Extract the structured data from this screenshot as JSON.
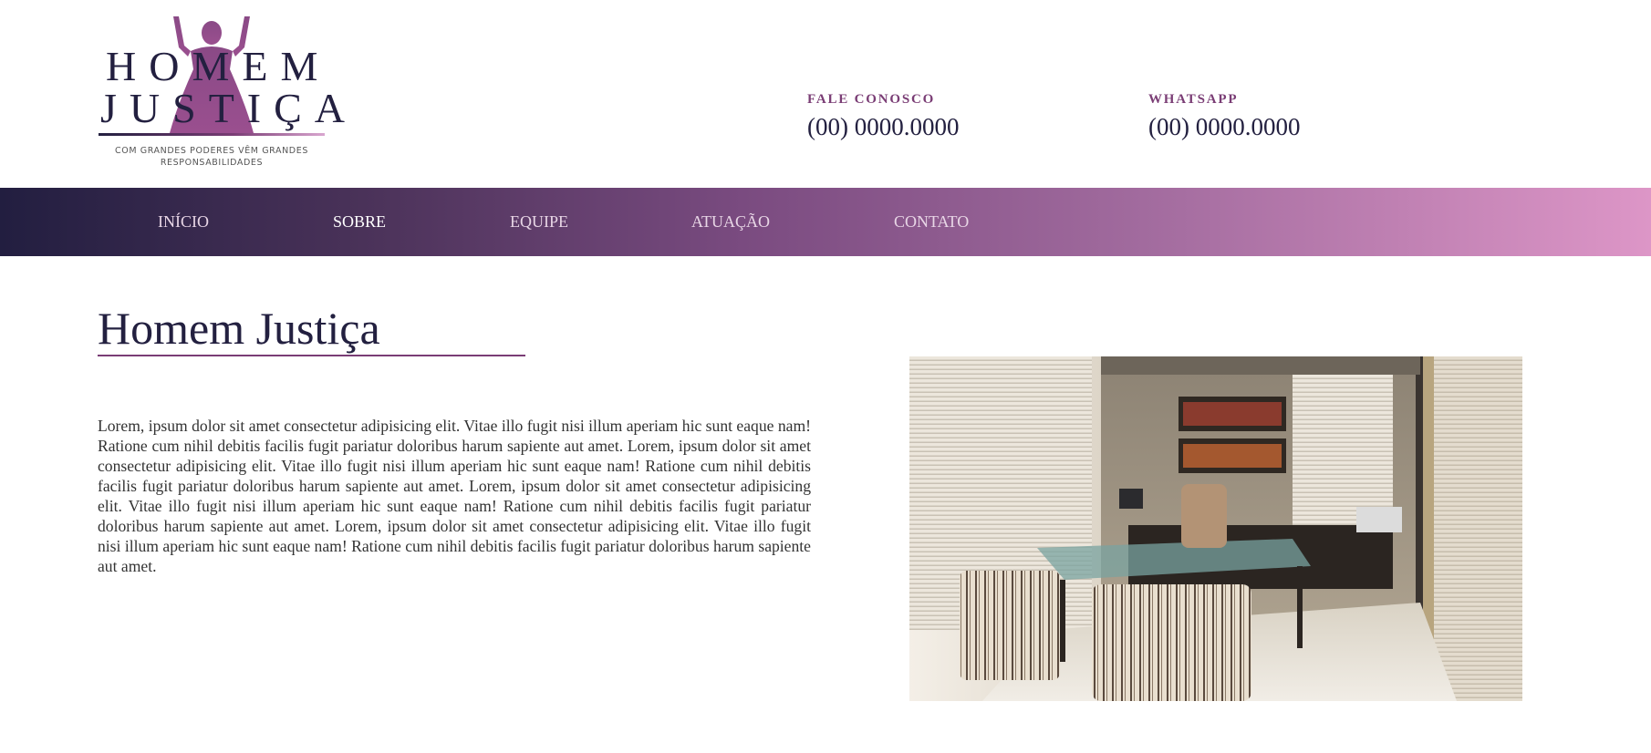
{
  "logo": {
    "line1": "HOMEM",
    "line2": "JUSTIÇA",
    "tagline_line1": "COM GRANDES PODERES VÊM GRANDES",
    "tagline_line2": "RESPONSABILIDADES",
    "figure_icon": "raised-arms-woman-silhouette"
  },
  "contacts": [
    {
      "label": "FALE CONOSCO",
      "value": "(00) 0000.0000"
    },
    {
      "label": "WHATSAPP",
      "value": "(00) 0000.0000"
    }
  ],
  "nav": {
    "items": [
      {
        "label": "INÍCIO",
        "active": false
      },
      {
        "label": "SOBRE",
        "active": true
      },
      {
        "label": "EQUIPE",
        "active": false
      },
      {
        "label": "ATUAÇÃO",
        "active": false
      },
      {
        "label": "CONTATO",
        "active": false
      }
    ]
  },
  "main": {
    "title": "Homem Justiça",
    "body": "Lorem, ipsum dolor sit amet consectetur adipisicing elit. Vitae illo fugit nisi illum aperiam hic sunt eaque nam! Ratione cum nihil debitis facilis fugit pariatur doloribus harum sapiente aut amet. Lorem, ipsum dolor sit amet consectetur adipisicing elit. Vitae illo fugit nisi illum aperiam hic sunt eaque nam! Ratione cum nihil debitis facilis fugit pariatur doloribus harum sapiente aut amet. Lorem, ipsum dolor sit amet consectetur adipisicing elit. Vitae illo fugit nisi illum aperiam hic sunt eaque nam! Ratione cum nihil debitis facilis fugit pariatur doloribus harum sapiente aut amet. Lorem, ipsum dolor sit amet consectetur adipisicing elit. Vitae illo fugit nisi illum aperiam hic sunt eaque nam! Ratione cum nihil debitis facilis fugit pariatur doloribus harum sapiente aut amet."
  },
  "colors": {
    "brand_dark": "#232040",
    "brand_purple": "#7a3d75",
    "brand_pink": "#dd96c7"
  }
}
